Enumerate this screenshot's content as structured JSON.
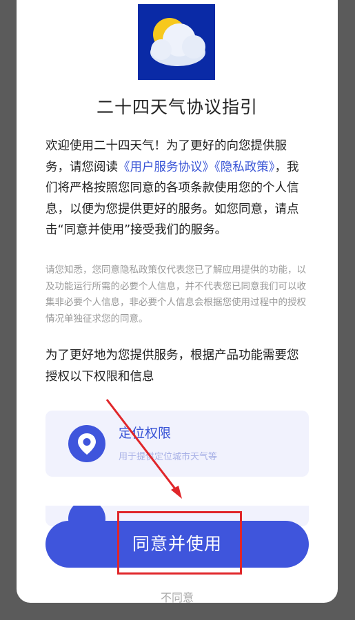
{
  "dialog": {
    "title": "二十四天气协议指引",
    "intro": {
      "part1": "欢迎使用二十四天气！为了更好的向您提供服务，请您阅读",
      "user_agreement_link": "《用户服务协议》",
      "privacy_policy_link": "《隐私政策》",
      "part2": "，我们将严格按照您同意的各项条款使用您的个人信息，以便为您提供更好的服务。如您同意，请点击“同意并使用”接受我们的服务。"
    },
    "notice": "请您知悉，您同意隐私政策仅代表您已了解应用提供的功能，以及功能运行所需的必要个人信息，并不代表您已同意我们可以收集非必要个人信息，非必要个人信息会根据您使用过程中的授权情况单独征求您的同意。",
    "permission_intro": "为了更好地为您提供服务，根据产品功能需要您授权以下权限和信息",
    "permissions": [
      {
        "name": "定位权限",
        "description": "用于提供定位城市天气等",
        "icon": "location-pin-icon"
      },
      {
        "name": "",
        "description": "",
        "icon": "permission-icon"
      }
    ],
    "agree_button": "同意并使用",
    "disagree_button": "不同意"
  },
  "colors": {
    "accent": "#3f55dc",
    "link": "#3a55d6",
    "card_bg": "#f1f2fd",
    "annotation": "#e0262a",
    "app_icon_bg": "#0a2aa6",
    "overlay": "#5b5b5b"
  }
}
